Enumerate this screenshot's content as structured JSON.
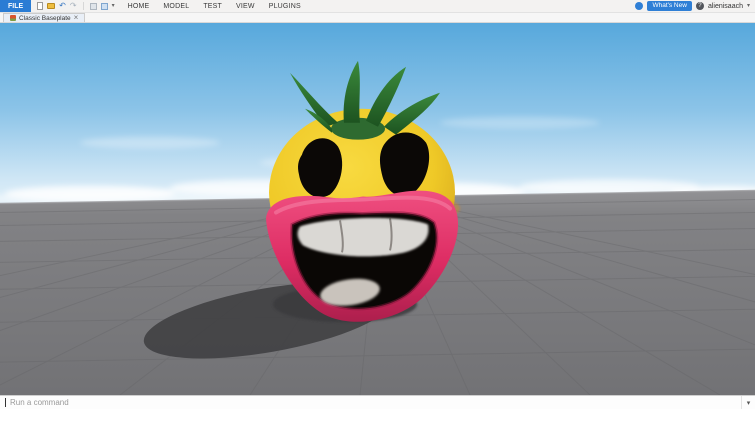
{
  "menubar": {
    "file_label": "FILE",
    "menus": [
      {
        "label": "HOME"
      },
      {
        "label": "MODEL"
      },
      {
        "label": "TEST"
      },
      {
        "label": "VIEW"
      },
      {
        "label": "PLUGINS"
      }
    ],
    "whats_new_label": "What's New",
    "username": "alienisaach"
  },
  "tabbar": {
    "tabs": [
      {
        "label": "Classic Baseplate",
        "active": true
      }
    ]
  },
  "icons": {
    "undo": "↶",
    "redo": "↷",
    "chevron_down": "▾",
    "close": "×",
    "help": "?"
  },
  "commandbar": {
    "placeholder": "Run a command"
  },
  "viewport": {
    "colors": {
      "sky_top": "#57a8dc",
      "sky_horizon": "#eaf5fb",
      "baseplate": "#7c7c7f",
      "character_head": "#eec529",
      "character_leaves": "#2e6a30",
      "character_lips": "#dd2c63",
      "character_mouth": "#0a0705",
      "shadow": "#404043"
    }
  }
}
